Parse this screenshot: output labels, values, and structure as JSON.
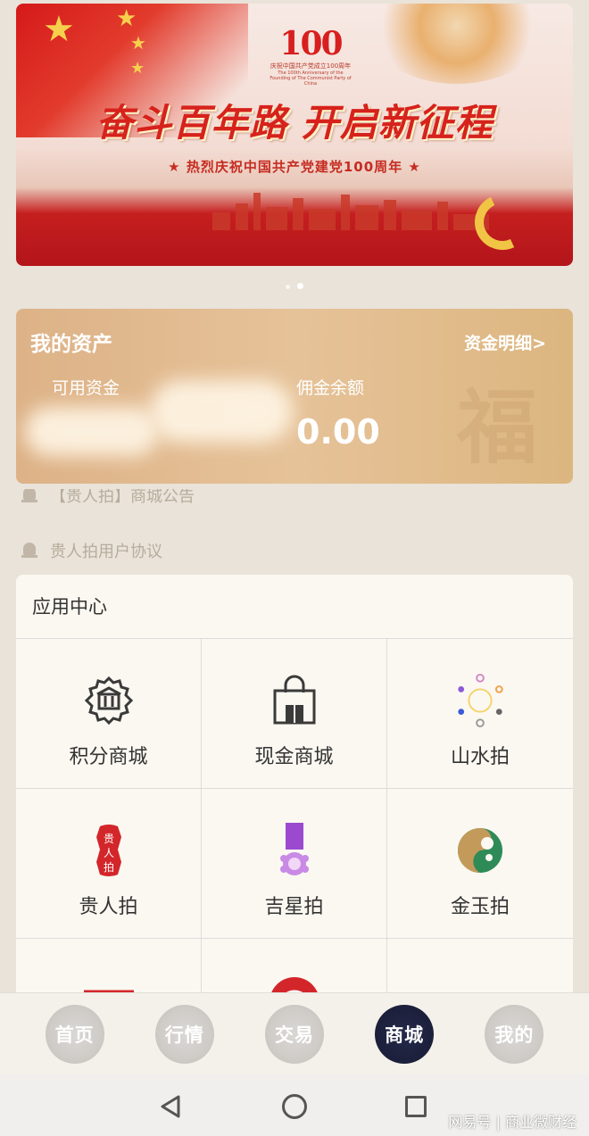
{
  "banner": {
    "logo_number": "100",
    "logo_sub1": "庆祝中国共产党成立100周年",
    "logo_sub2": "The 100th Anniversary of the Founding of The Communist Party of China",
    "headline": "奋斗百年路  开启新征程",
    "subline": "★ 热烈庆祝中国共产党建党100周年 ★",
    "dots": 2,
    "active_dot": 2
  },
  "assets": {
    "title": "我的资产",
    "detail_link": "资金明细>",
    "available_label": "可用资金",
    "commission_label": "佣金余额",
    "commission_value": "0.00"
  },
  "notices": [
    {
      "text": "【贵人拍】商城公告"
    },
    {
      "text": "贵人拍用户协议"
    }
  ],
  "app_center": {
    "title": "应用中心",
    "items": [
      {
        "label": "积分商城",
        "icon": "points-mall-icon"
      },
      {
        "label": "现金商城",
        "icon": "cash-mall-icon"
      },
      {
        "label": "山水拍",
        "icon": "shanshui-auction-icon"
      },
      {
        "label": "贵人拍",
        "icon": "guirenpai-icon"
      },
      {
        "label": "吉星拍",
        "icon": "jixingpai-icon"
      },
      {
        "label": "金玉拍",
        "icon": "jinyupai-icon"
      }
    ]
  },
  "tabbar": {
    "items": [
      {
        "label": "首页",
        "active": false
      },
      {
        "label": "行情",
        "active": false
      },
      {
        "label": "交易",
        "active": false
      },
      {
        "label": "商城",
        "active": true
      },
      {
        "label": "我的",
        "active": false
      }
    ]
  },
  "watermark": "网易号 | 商业微财经",
  "colors": {
    "primary_red": "#d7221c",
    "asset_gold": "#e0b985",
    "active_tab": "#1b1f3a"
  }
}
